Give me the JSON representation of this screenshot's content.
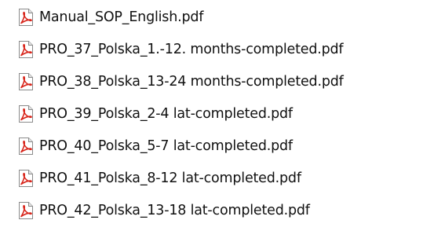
{
  "file_list": {
    "icon": "pdf-file-icon",
    "accent_color": "#d8261c",
    "items": [
      {
        "name": "Manual_SOP_English.pdf"
      },
      {
        "name": "PRO_37_Polska_1.-12. months-completed.pdf"
      },
      {
        "name": "PRO_38_Polska_13-24 months-completed.pdf"
      },
      {
        "name": "PRO_39_Polska_2-4 lat-completed.pdf"
      },
      {
        "name": "PRO_40_Polska_5-7 lat-completed.pdf"
      },
      {
        "name": "PRO_41_Polska_8-12 lat-completed.pdf"
      },
      {
        "name": "PRO_42_Polska_13-18 lat-completed.pdf"
      }
    ]
  }
}
